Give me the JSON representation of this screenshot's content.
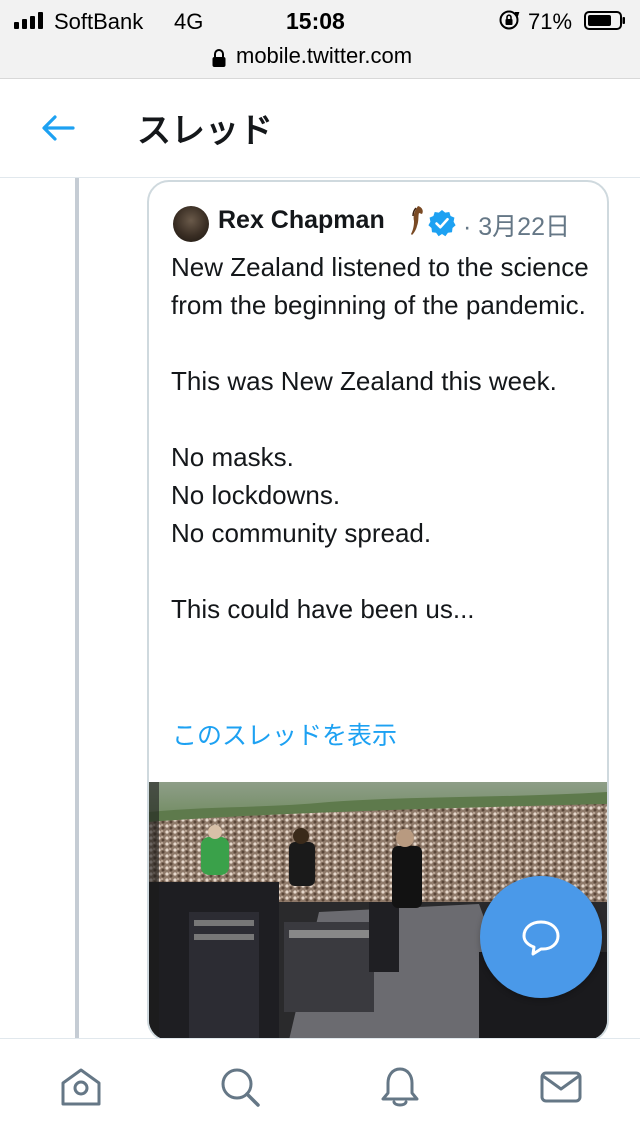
{
  "status_bar": {
    "carrier": "SoftBank",
    "network": "4G",
    "time": "15:08",
    "battery_percent": "71%"
  },
  "browser": {
    "url": "mobile.twitter.com"
  },
  "header": {
    "title": "スレッド",
    "back_icon": "arrow-left-icon"
  },
  "quoted_tweet": {
    "author": "Rex Chapman",
    "verified": true,
    "date": "· 3月22日",
    "paragraphs": [
      "New Zealand listened to the science from the beginning of the pandemic.",
      "",
      "This was New Zealand this week.",
      "",
      "No masks.",
      "No lockdowns.",
      "No community spread.",
      "",
      "This could have been us..."
    ],
    "show_thread_label": "このスレッドを表示",
    "media": "video-thumbnail-concert-crowd"
  },
  "compose_button": {
    "icon": "compose-bubble-icon"
  },
  "bottom_nav": {
    "items": [
      "home-icon",
      "search-icon",
      "notifications-bell-icon",
      "messages-envelope-icon"
    ]
  },
  "colors": {
    "accent": "#1da1f2",
    "fab": "#4a99e9",
    "secondary_text": "#657786",
    "border": "#cfd9de"
  }
}
